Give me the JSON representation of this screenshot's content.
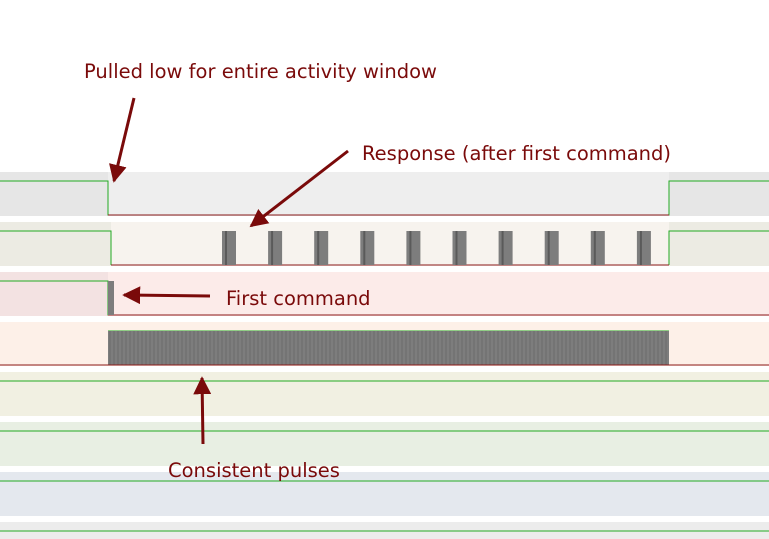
{
  "colors": {
    "annotation": "#7a0a0a",
    "high_line": "#22aa22",
    "low_line": "#8b1a1a",
    "pulse": "#7d7d7d",
    "lane_backgrounds": [
      "#e6e6e6",
      "#ecebe3",
      "#f3e2e2",
      "#fdf0e8",
      "#f1f0e2",
      "#e8efe3",
      "#e4e8ee",
      "#ececec"
    ]
  },
  "annotations": {
    "pulled_low": "Pulled low for entire activity window",
    "response": "Response (after first command)",
    "first_command": "First command",
    "consistent_pulses": "Consistent pulses"
  },
  "signals": {
    "channel_count": 8,
    "response_burst_count": 10,
    "first_command_pulse_count": 1
  }
}
